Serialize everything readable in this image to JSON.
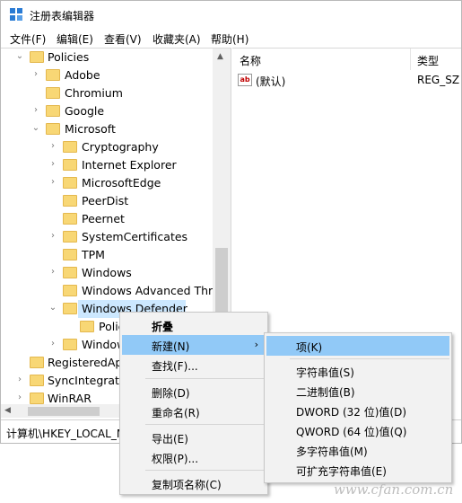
{
  "window": {
    "title": "注册表编辑器"
  },
  "menubar": [
    "文件(F)",
    "编辑(E)",
    "查看(V)",
    "收藏夹(A)",
    "帮助(H)"
  ],
  "tree": [
    {
      "label": "Policies",
      "chev": "v"
    },
    {
      "label": "Adobe",
      "chev": ">"
    },
    {
      "label": "Chromium",
      "chev": ""
    },
    {
      "label": "Google",
      "chev": ">"
    },
    {
      "label": "Microsoft",
      "chev": "v"
    },
    {
      "label": "Cryptography",
      "chev": ">"
    },
    {
      "label": "Internet Explorer",
      "chev": ">"
    },
    {
      "label": "MicrosoftEdge",
      "chev": ">"
    },
    {
      "label": "PeerDist",
      "chev": ""
    },
    {
      "label": "Peernet",
      "chev": ""
    },
    {
      "label": "SystemCertificates",
      "chev": ">"
    },
    {
      "label": "TPM",
      "chev": ""
    },
    {
      "label": "Windows",
      "chev": ">"
    },
    {
      "label": "Windows Advanced Thre",
      "chev": ""
    },
    {
      "label": "Windows Defender",
      "chev": "v"
    },
    {
      "label": "Polic",
      "chev": ""
    },
    {
      "label": "Window",
      "chev": ">"
    },
    {
      "label": "RegisteredAp",
      "chev": ""
    },
    {
      "label": "SyncIntegratio",
      "chev": ">"
    },
    {
      "label": "WinRAR",
      "chev": ">"
    }
  ],
  "list": {
    "col_name": "名称",
    "col_type": "类型",
    "rows": [
      {
        "name": "(默认)",
        "type": "REG_SZ",
        "icon": "ab-icon"
      }
    ]
  },
  "status": "计算机\\HKEY_LOCAL_MACHINE",
  "context_menu": [
    "折叠",
    "新建(N)",
    "查找(F)...",
    "删除(D)",
    "重命名(R)",
    "导出(E)",
    "权限(P)...",
    "复制项名称(C)"
  ],
  "submenu": [
    "项(K)",
    "字符串值(S)",
    "二进制值(B)",
    "DWORD (32 位)值(D)",
    "QWORD (64 位)值(Q)",
    "多字符串值(M)",
    "可扩充字符串值(E)"
  ],
  "watermark": "www.cfan.com.cn",
  "colors": {
    "selected_row": "#cce8ff",
    "menu_highlight": "#91c9f7",
    "folder": "#f8d775"
  }
}
